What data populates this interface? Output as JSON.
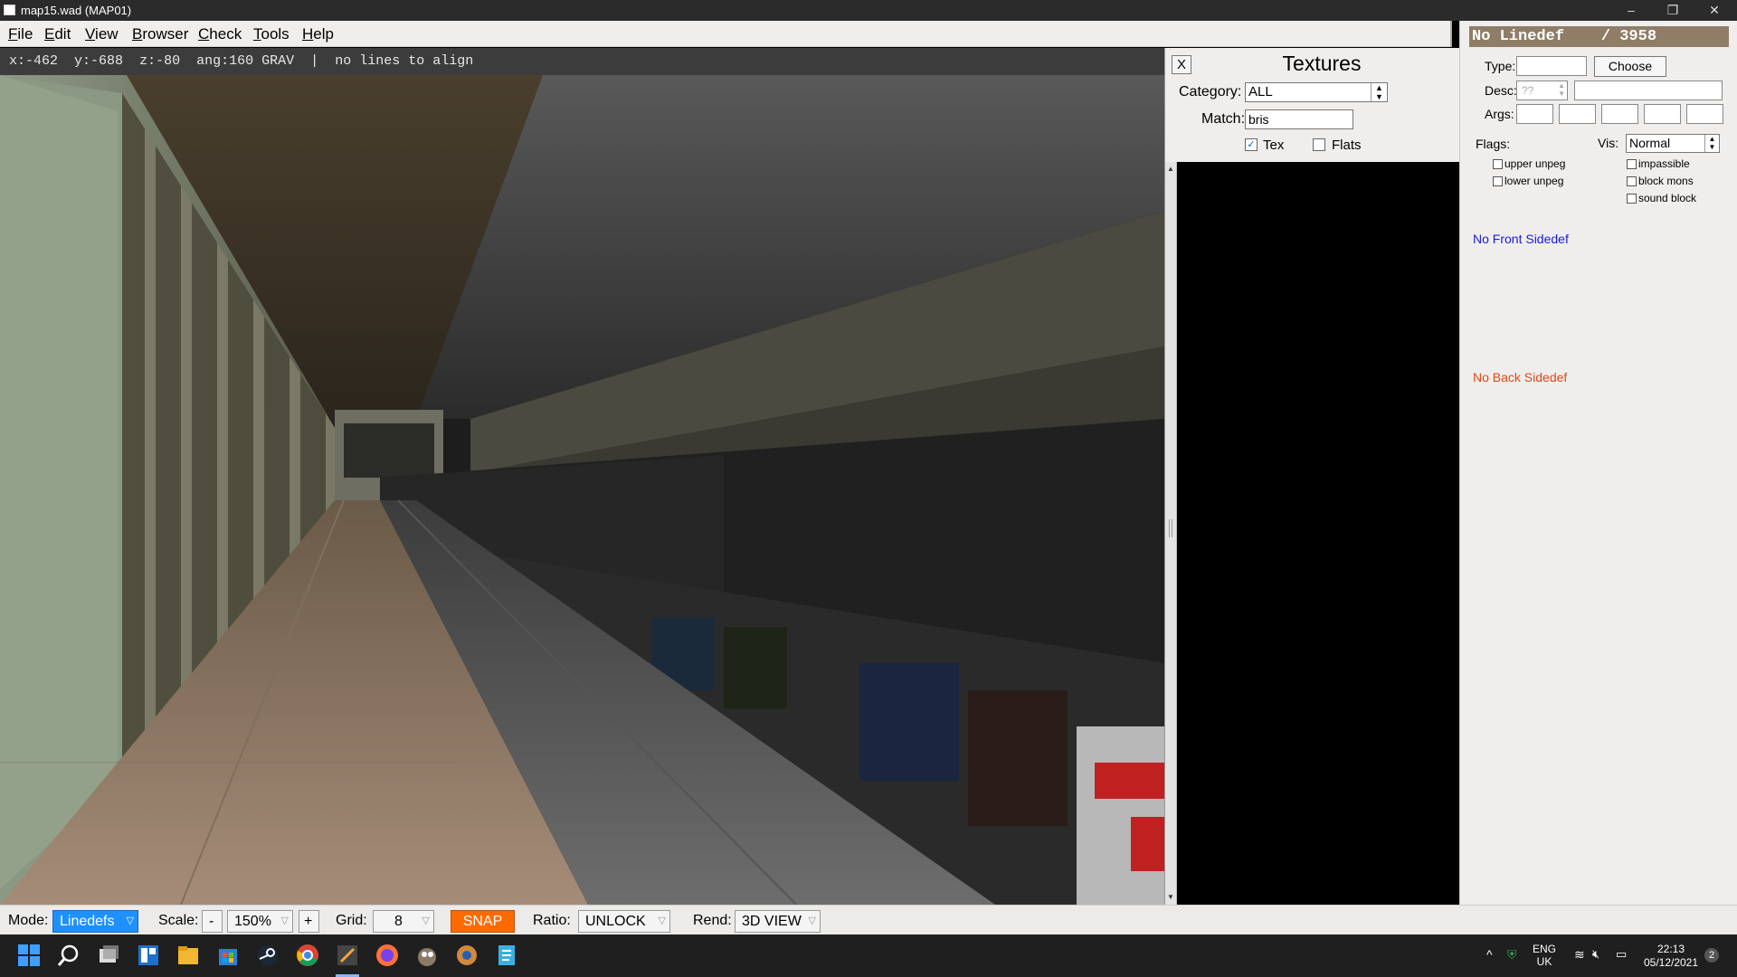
{
  "window": {
    "title": "map15.wad (MAP01)",
    "controls": {
      "minimize": "–",
      "restore": "❐",
      "close": "✕"
    }
  },
  "menu": [
    "File",
    "Edit",
    "View",
    "Browser",
    "Check",
    "Tools",
    "Help"
  ],
  "status": {
    "x": "x:-462",
    "y": "y:-688",
    "z": "z:-80",
    "ang": "ang:160",
    "grav": "GRAV",
    "sep": "|",
    "message": "no lines to align"
  },
  "textures_panel": {
    "close_label": "X",
    "title": "Textures",
    "category_label": "Category:",
    "category_value": "ALL",
    "match_label": "Match:",
    "match_value": "bris",
    "tex_label": "Tex",
    "tex_checked": true,
    "flats_label": "Flats",
    "flats_checked": false
  },
  "linedef_panel": {
    "header": "No Linedef    / 3958",
    "type_label": "Type:",
    "choose_label": "Choose",
    "desc_label": "Desc:",
    "desc_spinner": "??",
    "args_label": "Args:",
    "flags_label": "Flags:",
    "vis_label": "Vis:",
    "vis_value": "Normal",
    "flags": {
      "upper_unpeg": "upper unpeg",
      "lower_unpeg": "lower unpeg",
      "impassible": "impassible",
      "block_mons": "block mons",
      "sound_block": "sound block"
    },
    "front_sidedef": "No Front Sidedef",
    "back_sidedef": "No Back Sidedef",
    "colors": {
      "front": "#1a1ad6",
      "back": "#e0461a",
      "header_bg": "#8f7d67"
    }
  },
  "bottombar": {
    "mode_label": "Mode:",
    "mode_value": "Linedefs",
    "scale_label": "Scale:",
    "scale_minus": "-",
    "scale_value": "150%",
    "scale_plus": "+",
    "grid_label": "Grid:",
    "grid_value": "8",
    "snap_label": "SNAP",
    "ratio_label": "Ratio:",
    "ratio_value": "UNLOCK",
    "rend_label": "Rend:",
    "rend_value": "3D VIEW",
    "colors": {
      "mode": "#1e90ff",
      "snap": "#ff6a00"
    }
  },
  "taskbar": {
    "icons": [
      "windows-start-icon",
      "search-icon",
      "task-view-icon",
      "widgets-icon",
      "file-explorer-icon",
      "microsoft-store-icon",
      "steam-icon",
      "chrome-icon",
      "eureka-editor-icon",
      "firefox-icon",
      "gimp-icon",
      "slade-icon",
      "notepad-icon"
    ],
    "tray": {
      "language": "ENG",
      "region": "UK",
      "time": "22:13",
      "date": "05/12/2021",
      "notifications": "2"
    }
  }
}
